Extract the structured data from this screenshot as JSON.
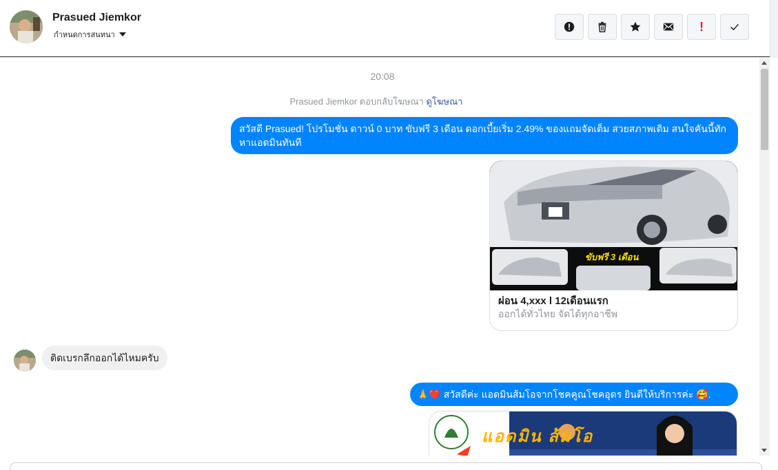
{
  "header": {
    "name": "Prasued Jiemkor",
    "subtitle": "กำหนดการสนทนา",
    "toolbar": [
      {
        "id": "spam",
        "icon": "exclamation-circle-icon"
      },
      {
        "id": "delete",
        "icon": "trash-icon"
      },
      {
        "id": "star",
        "icon": "star-icon"
      },
      {
        "id": "unread",
        "icon": "envelope-icon"
      },
      {
        "id": "follow-up",
        "icon": "exclamation-icon"
      },
      {
        "id": "done",
        "icon": "check-icon"
      }
    ]
  },
  "conversation": {
    "timestamp": "20:08",
    "ad_reply_text": "Prasued Jiemkor ตอบกลับโฆษณา",
    "ad_reply_link": "ดูโฆษณา",
    "message_out_1": "สวัสดี Prasued! โปรโมชั่น ดาวน์ 0 บาท ขับฟรี 3 เดือน ดอกเบี้ยเริ่ม 2.49% ของแถมจัดเต็ม สวยสภาพเดิม สนใจคันนี้ทักหาแอดมินทันที",
    "card": {
      "image_caption": "ขับฟรี 3 เดือน",
      "title": "ผ่อน 4,xxx l 12เดือนแรก",
      "subtitle": "ออกได้ทั่วไทย จัดได้ทุกอาชีพ"
    },
    "message_in_1": "ติดเบรกลึกออกได้ไหมครับ",
    "message_out_2": "🙏❤️ สวัสดีค่ะ แอดมินส้มโอจากโชคคูณโชคอุดร ยินดีให้บริการค่ะ 🥰.",
    "image2_caption": "แอดมิน ส้มโอ"
  },
  "colors": {
    "accent": "#0084ff",
    "incoming_bubble": "#f1f0f0",
    "header_border": "#1c1e21"
  }
}
